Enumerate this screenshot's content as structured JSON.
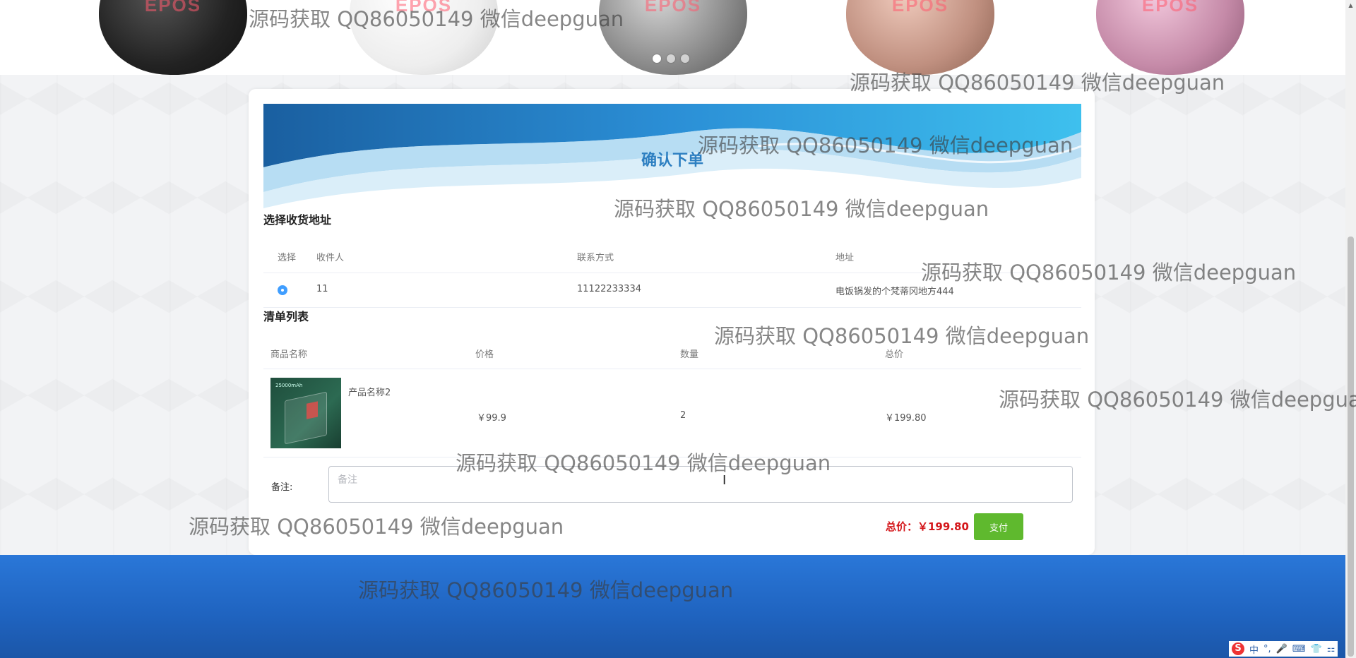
{
  "carousel": {
    "brand_text": [
      "EPOS",
      "EPOS",
      "EPOS",
      "EPOS",
      "EPOS"
    ],
    "slide_count": 3,
    "active_slide": 1
  },
  "order": {
    "title": "确认下单",
    "address_section_title": "选择收货地址",
    "address_headers": [
      "选择",
      "收件人",
      "联系方式",
      "地址"
    ],
    "address_rows": [
      {
        "selected": true,
        "recipient": "11",
        "phone": "11122233334",
        "address": "电饭锅发的个梵蒂冈地方444"
      }
    ],
    "items_section_title": "清单列表",
    "item_headers": [
      "商品名称",
      "价格",
      "数量",
      "总价"
    ],
    "items": [
      {
        "name": "产品名称2",
        "price": "￥99.9",
        "quantity": "2",
        "subtotal": "￥199.80",
        "thumb_text": "25000mAh"
      }
    ],
    "remark_label": "备注:",
    "remark_placeholder": "备注",
    "total_text": "总价：￥199.80",
    "pay_label": "支付"
  },
  "watermark_text": "源码获取 QQ86050149 微信deepguan",
  "ime": {
    "logo": "S",
    "items": [
      "中",
      "°,",
      "🎤",
      "⌨",
      "👕",
      "⚏"
    ]
  },
  "colors": {
    "accent_blue": "#2d7fc1",
    "price_red": "#d4171b",
    "pay_green": "#5fb92e",
    "footer_blue": "#2a77d8"
  }
}
